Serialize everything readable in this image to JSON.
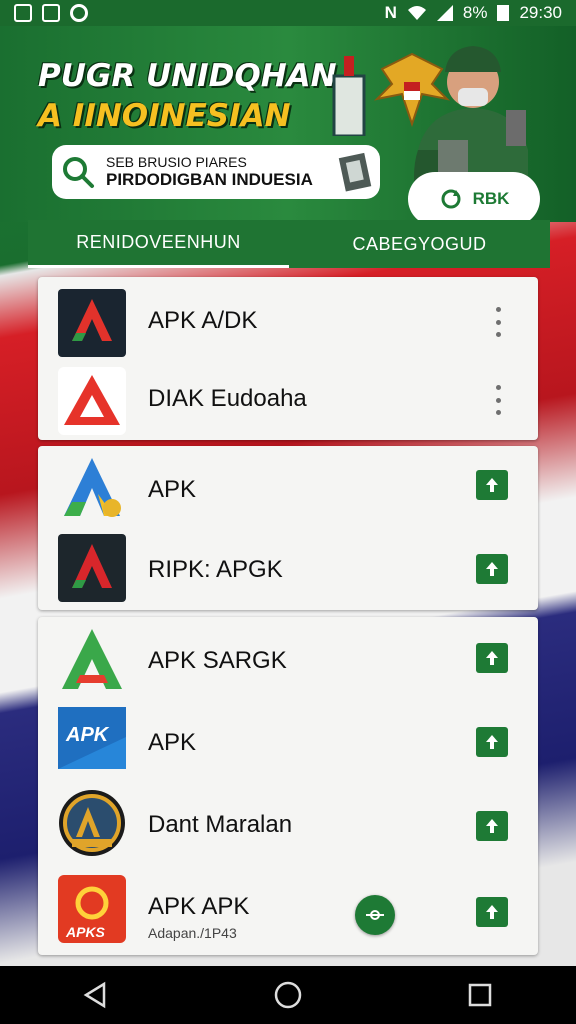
{
  "status_bar": {
    "battery": "8%",
    "time": "29:30",
    "icons": [
      "sim-icon",
      "image-icon",
      "maps-icon",
      "nfc-icon",
      "wifi-icon",
      "signal-icon",
      "battery-icon"
    ]
  },
  "banner": {
    "title_line1": "PUGR UNIDQHAN",
    "title_line2": "A IINOINESIAN",
    "search_line1": "SEB BRUSIO PIARES",
    "search_line2": "PIRDODIGBAN INDUESIA",
    "button_label": "RBK"
  },
  "tabs": [
    {
      "label": "RENIDOVEENHUN"
    },
    {
      "label": "CABEGYOGUD"
    }
  ],
  "apps": [
    {
      "name": "APK A/DK"
    },
    {
      "name": "DIAK Eudoaha"
    },
    {
      "name": "APK"
    },
    {
      "name": "RIPK: APGK"
    },
    {
      "name": "APK SARGK"
    },
    {
      "name": "APK"
    },
    {
      "name": "Dant Maralan"
    },
    {
      "name": "APK APK",
      "sub": "Adapan./1P43"
    }
  ],
  "colors": {
    "brand_green": "#1e7a35",
    "status_bar": "#1b6a2d",
    "card_bg": "#f5f5f3"
  }
}
